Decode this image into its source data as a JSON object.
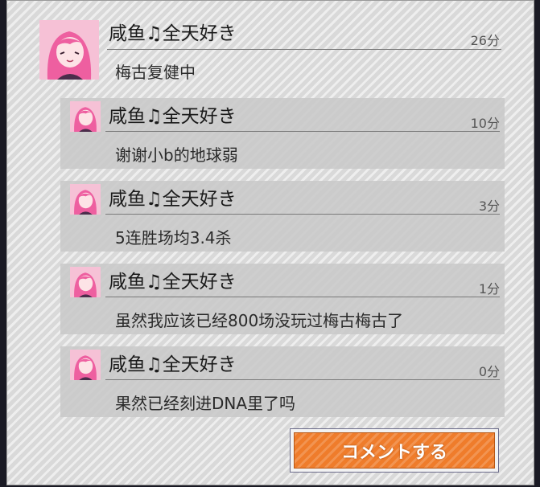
{
  "comments": [
    {
      "name": "咸鱼♫全天好き",
      "time": "26分",
      "text": "梅古复健中"
    },
    {
      "name": "咸鱼♫全天好き",
      "time": "10分",
      "text": "谢谢小b的地球弱"
    },
    {
      "name": "咸鱼♫全天好き",
      "time": "3分",
      "text": "5连胜场均3.4杀"
    },
    {
      "name": "咸鱼♫全天好き",
      "time": "1分",
      "text": "虽然我应该已经800场没玩过梅古梅古了"
    },
    {
      "name": "咸鱼♫全天好き",
      "time": "0分",
      "text": "果然已经刻进DNA里了吗"
    }
  ],
  "comment_button": {
    "label": "コメントする"
  },
  "colors": {
    "accent": "#ef7c2b",
    "avatar": "#f4b6cf"
  },
  "icons": {
    "avatar": "anime-girl-avatar-icon"
  }
}
